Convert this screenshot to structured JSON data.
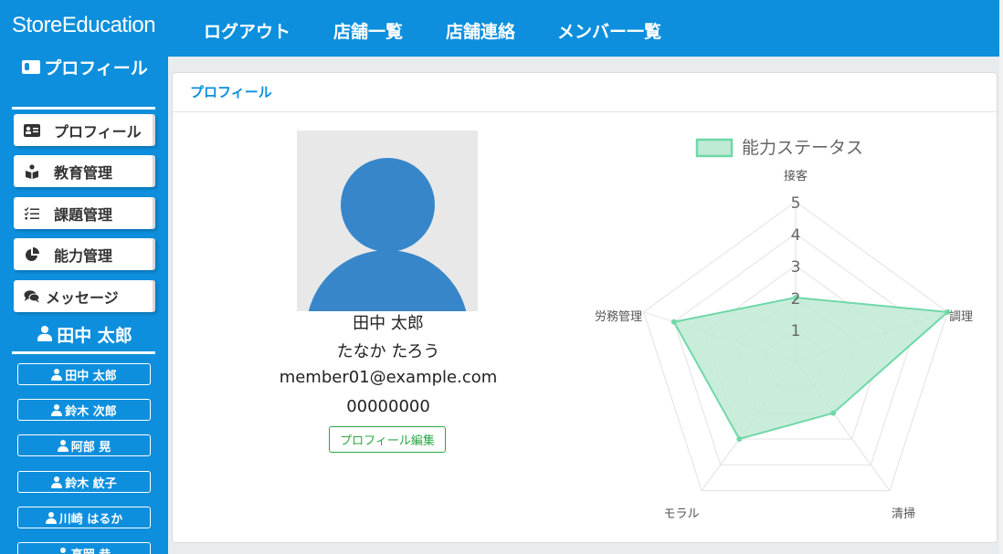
{
  "app": {
    "brand": "StoreEducation"
  },
  "nav": {
    "items": [
      "ログアウト",
      "店舗一覧",
      "店舗連絡",
      "メンバー一覧"
    ]
  },
  "sidebar": {
    "section_title": "プロフィール",
    "menu": [
      {
        "label": "プロフィール",
        "icon": "id-card-icon"
      },
      {
        "label": "教育管理",
        "icon": "book-reader-icon"
      },
      {
        "label": "課題管理",
        "icon": "task-list-icon"
      },
      {
        "label": "能力管理",
        "icon": "pie-chart-icon"
      },
      {
        "label": "メッセージ",
        "icon": "comments-icon"
      }
    ],
    "user_name": "田中 太郎",
    "members": [
      "田中 太郎",
      "鈴木 次郎",
      "阿部 晃",
      "鈴木 紋子",
      "川崎 はるか",
      "高岡 恭"
    ]
  },
  "main": {
    "header": "プロフィール",
    "profile": {
      "name": "田中 太郎",
      "kana": "たなか たろう",
      "email": "member01@example.com",
      "number": "00000000",
      "edit_label": "プロフィール編集"
    }
  },
  "colors": {
    "primary": "#0d8fdd",
    "radar_stroke": "#6fd8a8",
    "radar_fill": "#bfead4",
    "edit_button": "#28a745"
  },
  "chart_data": {
    "type": "radar",
    "legend": "能力ステータス",
    "legend_position": "top",
    "axes": [
      "接客",
      "調理",
      "清掃",
      "モラル",
      "労務管理"
    ],
    "values": [
      2,
      5,
      2,
      3,
      4
    ],
    "r_range": [
      0,
      5
    ],
    "ticks": [
      "1",
      "2",
      "3",
      "4",
      "5"
    ]
  }
}
